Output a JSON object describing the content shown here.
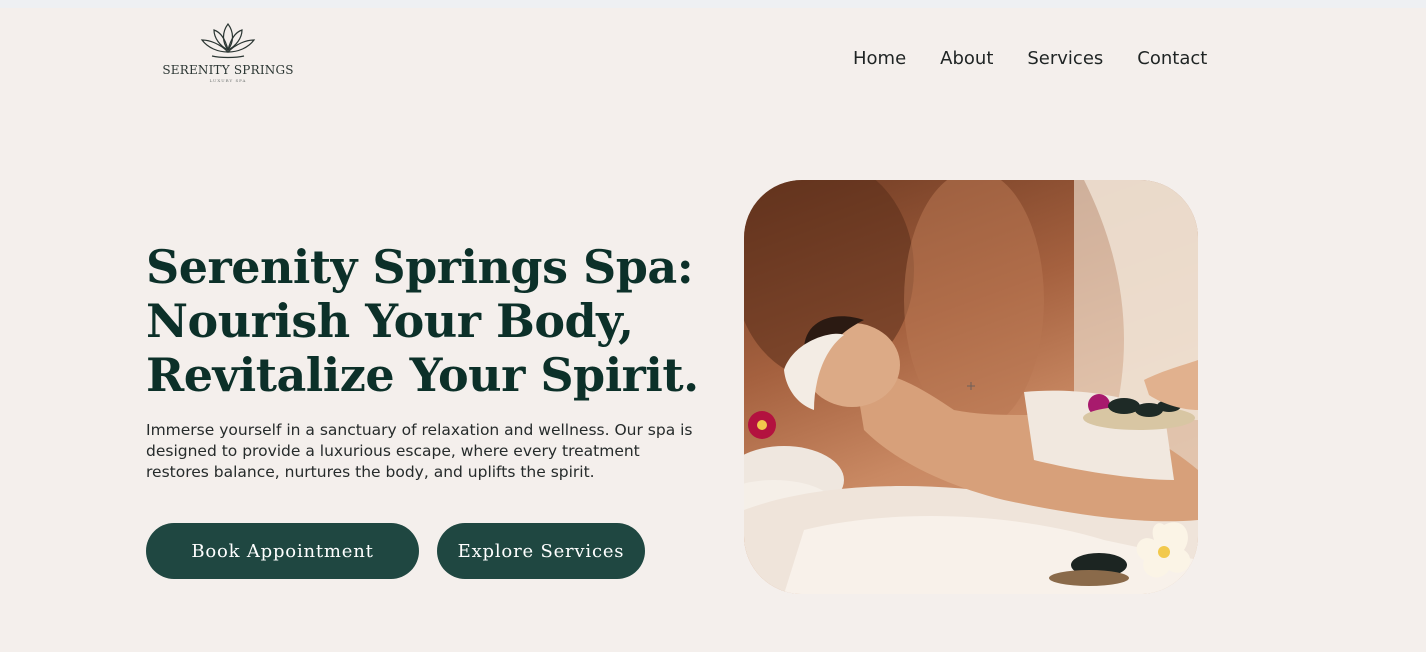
{
  "logo": {
    "name": "SERENITY SPRINGS",
    "tagline": "LUXURY SPA"
  },
  "nav": {
    "items": [
      {
        "label": "Home"
      },
      {
        "label": "About"
      },
      {
        "label": "Services"
      },
      {
        "label": "Contact"
      }
    ]
  },
  "hero": {
    "title_lines": [
      "Serenity Springs Spa:",
      "Nourish Your Body,",
      "Revitalize Your Spirit."
    ],
    "description": "Immerse yourself in a sanctuary of relaxation and wellness. Our spa is designed to provide a luxurious escape, where every treatment restores balance, nurtures the body, and uplifts the spirit.",
    "primary_button": "Book Appointment",
    "secondary_button": "Explore Services",
    "image_icon": "spa-massage-photo"
  },
  "colors": {
    "background": "#f4efec",
    "heading": "#0c3029",
    "button": "#1f4741",
    "button_text": "#ffffff"
  }
}
